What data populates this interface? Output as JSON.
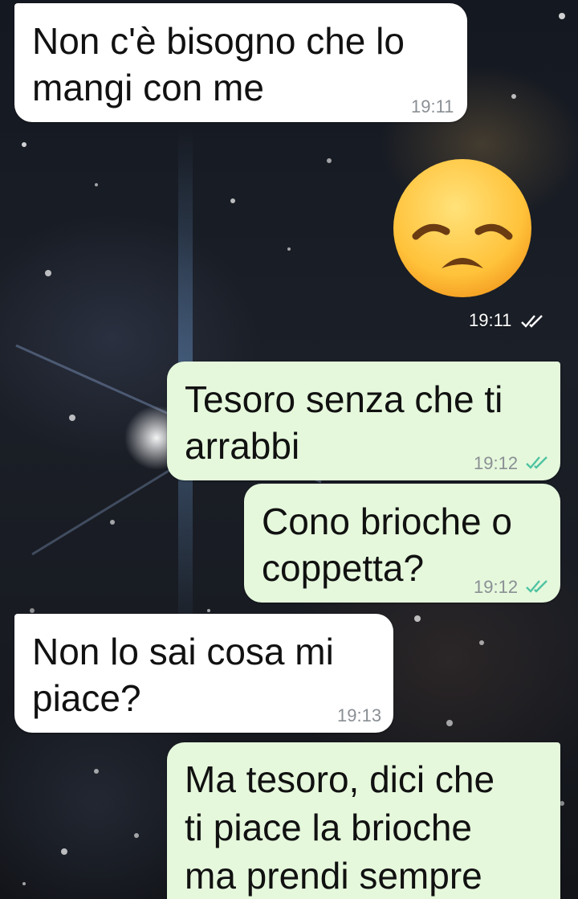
{
  "chat": {
    "messages": [
      {
        "direction": "incoming",
        "text": "Non c'è bisogno che lo\nmangi con me",
        "time": "19:11"
      },
      {
        "direction": "outgoing",
        "type": "emoji",
        "emoji_name": "disappointed-face",
        "time": "19:11",
        "status": "delivered"
      },
      {
        "direction": "outgoing",
        "text": "Tesoro senza che ti\narrabbi",
        "time": "19:12",
        "status": "read"
      },
      {
        "direction": "outgoing",
        "text": "Cono brioche o\ncoppetta?",
        "time": "19:12",
        "status": "read"
      },
      {
        "direction": "incoming",
        "text": "Non lo sai cosa mi\npiace?",
        "time": "19:13"
      },
      {
        "direction": "outgoing",
        "text": "Ma tesoro, dici che\nti piace la brioche\nma prendi sempre",
        "time": "",
        "status": ""
      }
    ]
  },
  "colors": {
    "incoming_bubble": "#ffffff",
    "outgoing_bubble": "#e5f8dc",
    "read_ticks": "#4fc3a1",
    "time_text": "#8a8f94"
  }
}
